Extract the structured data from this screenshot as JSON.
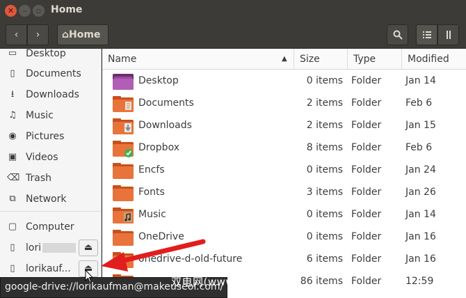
{
  "window": {
    "title": "Home"
  },
  "toolbar": {
    "path_label": "Home"
  },
  "sidebar": {
    "items": [
      {
        "label": "Desktop",
        "icon": "desktop-icon",
        "glyph": "▭"
      },
      {
        "label": "Documents",
        "icon": "document-icon",
        "glyph": "▯"
      },
      {
        "label": "Downloads",
        "icon": "download-icon",
        "glyph": "⭳"
      },
      {
        "label": "Music",
        "icon": "music-icon",
        "glyph": "♫"
      },
      {
        "label": "Pictures",
        "icon": "camera-icon",
        "glyph": "◉"
      },
      {
        "label": "Videos",
        "icon": "video-icon",
        "glyph": "▣"
      },
      {
        "label": "Trash",
        "icon": "trash-icon",
        "glyph": "⌫"
      },
      {
        "label": "Network",
        "icon": "network-icon",
        "glyph": "⧉"
      }
    ],
    "devices": [
      {
        "label": "Computer",
        "icon": "computer-icon",
        "glyph": "▢"
      },
      {
        "label": "lori",
        "icon": "drive-icon",
        "glyph": "▯",
        "blurred": true
      },
      {
        "label": "lorikauf...",
        "icon": "drive-icon",
        "glyph": "▯"
      }
    ]
  },
  "columns": {
    "name": "Name",
    "size": "Size",
    "type": "Type",
    "modified": "Modified"
  },
  "files": [
    {
      "name": "Desktop",
      "size": "0 items",
      "type": "Folder",
      "modified": "Jan 14",
      "variant": "desktop"
    },
    {
      "name": "Documents",
      "size": "2 items",
      "type": "Folder",
      "modified": "Feb 6",
      "variant": "documents"
    },
    {
      "name": "Downloads",
      "size": "2 items",
      "type": "Folder",
      "modified": "Jan 15",
      "variant": "downloads"
    },
    {
      "name": "Dropbox",
      "size": "8 items",
      "type": "Folder",
      "modified": "Feb 6",
      "variant": "dropbox"
    },
    {
      "name": "Encfs",
      "size": "0 items",
      "type": "Folder",
      "modified": "Jan 24",
      "variant": "plain"
    },
    {
      "name": "Fonts",
      "size": "3 items",
      "type": "Folder",
      "modified": "Jan 26",
      "variant": "plain"
    },
    {
      "name": "Music",
      "size": "0 items",
      "type": "Folder",
      "modified": "Jan 14",
      "variant": "music"
    },
    {
      "name": "OneDrive",
      "size": "0 items",
      "type": "Folder",
      "modified": "Jan 16",
      "variant": "plain"
    },
    {
      "name": "onedrive-d-old-future",
      "size": "6 items",
      "type": "Folder",
      "modified": "Jan 16",
      "variant": "plain"
    },
    {
      "name": "",
      "size": "86 items",
      "type": "Folder",
      "modified": "12:59",
      "variant": "plain"
    }
  ],
  "tooltip": {
    "text": "google-drive://lorikaufman@makeuseof.com/"
  },
  "watermark": {
    "text": "双电网(www.pcpc.me)"
  },
  "colors": {
    "accent": "#e0573a",
    "folder": "#e8743c",
    "arrow": "#e21d1d",
    "check": "#3fb14e"
  }
}
